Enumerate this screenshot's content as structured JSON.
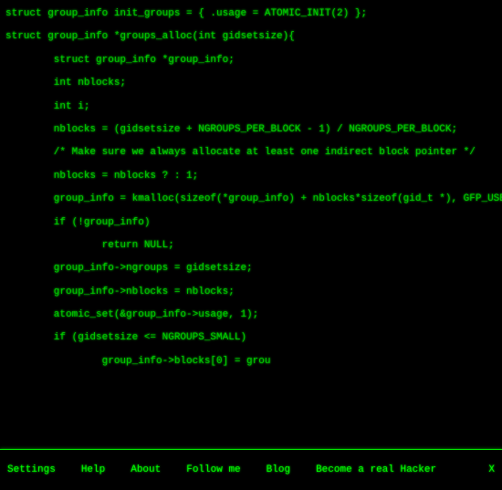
{
  "code": {
    "lines": [
      "struct group_info init_groups = { .usage = ATOMIC_INIT(2) };",
      "struct group_info *groups_alloc(int gidsetsize){",
      "        struct group_info *group_info;",
      "        int nblocks;",
      "        int i;",
      "",
      "        nblocks = (gidsetsize + NGROUPS_PER_BLOCK - 1) / NGROUPS_PER_BLOCK;",
      "        /* Make sure we always allocate at least one indirect block pointer */",
      "        nblocks = nblocks ? : 1;",
      "        group_info = kmalloc(sizeof(*group_info) + nblocks*sizeof(gid_t *), GFP_USER);",
      "        if (!group_info)",
      "                return NULL;",
      "        group_info->ngroups = gidsetsize;",
      "        group_info->nblocks = nblocks;",
      "        atomic_set(&group_info->usage, 1);",
      "",
      "        if (gidsetsize <= NGROUPS_SMALL)",
      "                group_info->blocks[0] = grou"
    ]
  },
  "bottombar": {
    "settings": "Settings",
    "help": "Help",
    "about": "About",
    "followme": "Follow me",
    "blog": "Blog",
    "becomehacker": "Become a real Hacker",
    "close": "X"
  }
}
